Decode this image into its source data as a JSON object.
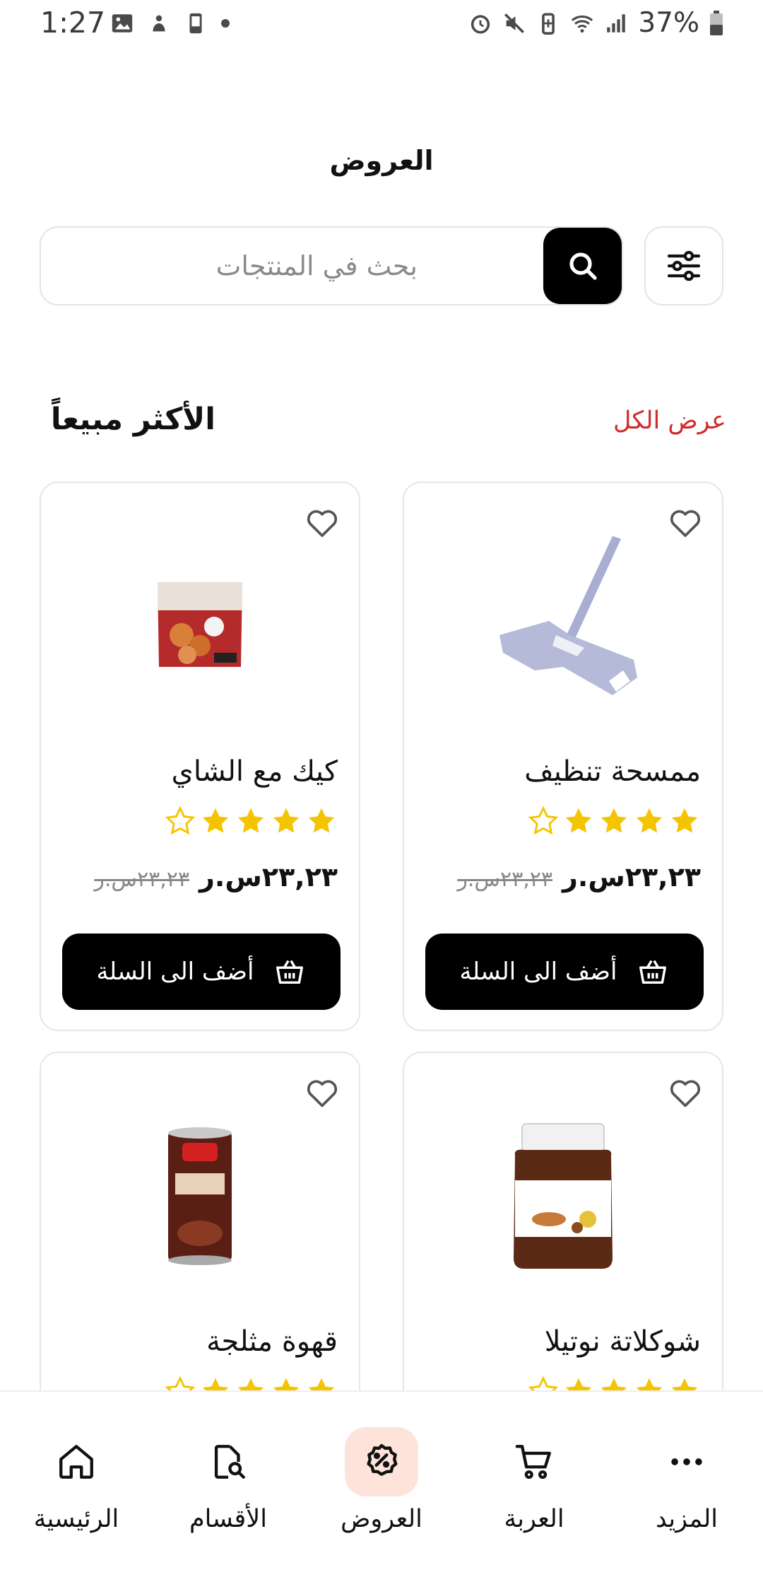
{
  "status_bar": {
    "time": "1:27",
    "battery": "37%"
  },
  "header": {
    "title": "العروض"
  },
  "search": {
    "placeholder": "بحث في المنتجات"
  },
  "section": {
    "title": "الأكثر مبيعاً",
    "view_all": "عرض الكل"
  },
  "products": [
    {
      "name": "كيك مع الشاي",
      "rating": 4,
      "max_rating": 5,
      "price": "٢٣,٢٣س.ر",
      "old_price": "٢٣,٢٣س.ر",
      "add_label": "أضف الى السلة"
    },
    {
      "name": "ممسحة تنظيف",
      "rating": 4,
      "max_rating": 5,
      "price": "٢٣,٢٣س.ر",
      "old_price": "٢٣,٢٣س.ر",
      "add_label": "أضف الى السلة"
    },
    {
      "name": "قهوة مثلجة",
      "rating": 4,
      "max_rating": 5
    },
    {
      "name": "شوكلاتة نوتيلا",
      "rating": 4,
      "max_rating": 5
    }
  ],
  "bottom_nav": [
    {
      "label": "الرئيسية",
      "icon": "home-icon",
      "active": false
    },
    {
      "label": "الأقسام",
      "icon": "categories-icon",
      "active": false
    },
    {
      "label": "العروض",
      "icon": "offers-icon",
      "active": true
    },
    {
      "label": "العربة",
      "icon": "cart-icon",
      "active": false
    },
    {
      "label": "المزيد",
      "icon": "more-icon",
      "active": false
    }
  ],
  "colors": {
    "accent_red": "#d12a2a",
    "star_yellow": "#f5c400",
    "active_nav_bg": "#fde3da",
    "button_black": "#000000"
  }
}
